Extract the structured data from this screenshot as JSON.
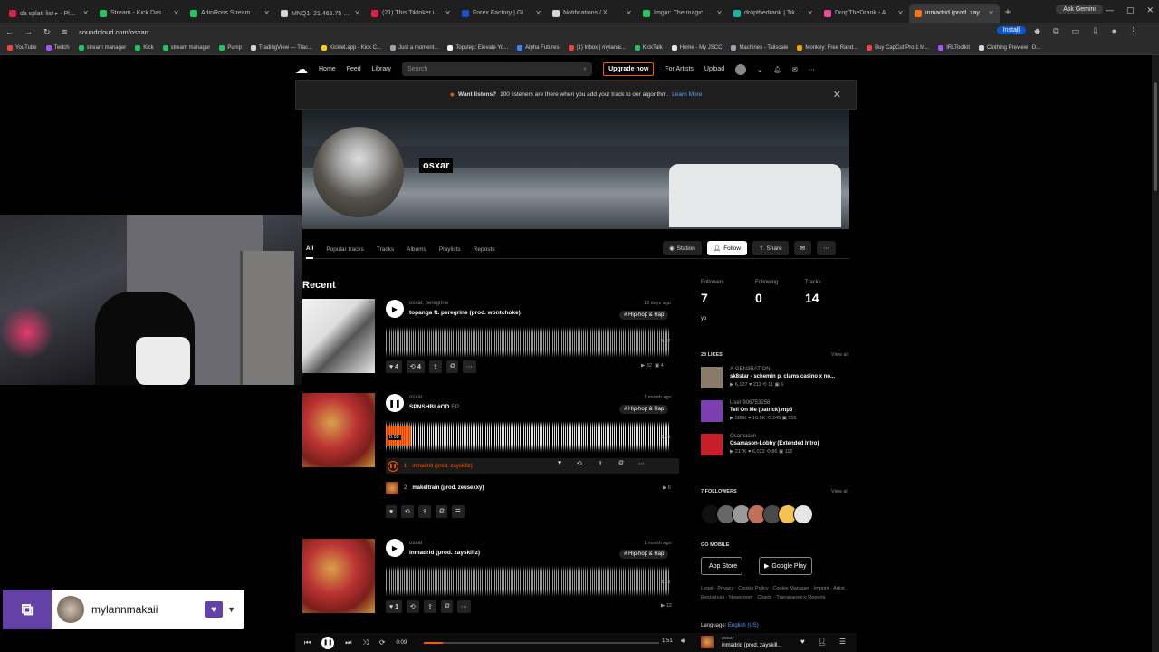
{
  "browser": {
    "tabs": [
      {
        "title": "da splatt list ▸ - Playlis",
        "color": "#e11d48"
      },
      {
        "title": "Stream - Kick Dashboard",
        "color": "#22c55e"
      },
      {
        "title": "AdinRoss Stream - Watc",
        "color": "#22c55e"
      },
      {
        "title": "MNQ1! 21,465.75 ▾ -0.",
        "color": "#d1d5db"
      },
      {
        "title": "(21) This Tiktoker is DM",
        "color": "#e11d48"
      },
      {
        "title": "Forex Factory | Global m",
        "color": "#1d4ed8"
      },
      {
        "title": "Notifications / X",
        "color": "#d1d5db"
      },
      {
        "title": "Imgur: The magic of the",
        "color": "#22c55e"
      },
      {
        "title": "dropthedrank | TikTok,",
        "color": "#14b8a6"
      },
      {
        "title": "DropTheDrank - Apple I",
        "color": "#ec4899"
      },
      {
        "title": "inmadrid (prod. zay",
        "color": "#f97316"
      }
    ],
    "new_tab": "+",
    "ask_gemini": "Ask Gemini",
    "url": "soundcloud.com/osxarr",
    "install": "Install",
    "bookmarks": [
      {
        "label": "YouTube",
        "color": "#ef4444"
      },
      {
        "label": "Twitch",
        "color": "#a855f7"
      },
      {
        "label": "stream manager",
        "color": "#22c55e"
      },
      {
        "label": "Kick",
        "color": "#22c55e"
      },
      {
        "label": "stream manager",
        "color": "#22c55e"
      },
      {
        "label": "Pump",
        "color": "#22c55e"
      },
      {
        "label": "TradingView — Trac...",
        "color": "#d1d5db"
      },
      {
        "label": "Kicklet.app - Kick C...",
        "color": "#facc15"
      },
      {
        "label": "Just a moment...",
        "color": "#9ca3af"
      },
      {
        "label": "Topstep: Elevate Yo...",
        "color": "#f3f4f6"
      },
      {
        "label": "Alpha Futures",
        "color": "#3b82f6"
      },
      {
        "label": "(1) Inbox | mylanai...",
        "color": "#ef4444"
      },
      {
        "label": "KickTalk",
        "color": "#22c55e"
      },
      {
        "label": "Home - My JSCC",
        "color": "#e5e7eb"
      },
      {
        "label": "Machines - Tailscale",
        "color": "#9ca3af"
      },
      {
        "label": "Monkey: Free Rand...",
        "color": "#f59e0b"
      },
      {
        "label": "Buy CapCut Pro 1 M...",
        "color": "#ef4444"
      },
      {
        "label": "IRLToolkit",
        "color": "#a855f7"
      },
      {
        "label": "Clothing Preview | D...",
        "color": "#d1d5db"
      }
    ]
  },
  "nav": {
    "home": "Home",
    "feed": "Feed",
    "library": "Library",
    "search_placeholder": "Search",
    "upgrade": "Upgrade now",
    "for_artists": "For Artists",
    "upload": "Upload"
  },
  "notice": {
    "strong": "Want listens?",
    "text": "100 listeners are there when you add your track to our algorithm.",
    "link": "Learn More"
  },
  "profile": {
    "name": "osxar",
    "tabs": [
      "All",
      "Popular tracks",
      "Tracks",
      "Albums",
      "Playlists",
      "Reposts"
    ],
    "station": "Station",
    "follow": "Follow",
    "share": "Share"
  },
  "recent_heading": "Recent",
  "tracks": [
    {
      "artist": "osxar, peregrine",
      "title": "topanga ft. peregrine (prod. wontchoke)",
      "age": "18 days ago",
      "genre": "# Hip-hop & Rap",
      "duration": "2:37",
      "likes": "4",
      "reposts": "4",
      "plays": "32",
      "comments": "4"
    },
    {
      "artist": "osxar",
      "title": "SPNSHBL#OD",
      "type": "EP",
      "age": "1 month ago",
      "genre": "# Hip-hop & Rap",
      "elapsed": "0:09",
      "duration": "1:51",
      "sub": [
        {
          "num": "1",
          "title": "inmadrid (prod. zayskillz)"
        },
        {
          "num": "2",
          "title": "makeitrain (prod. zeusexxy)",
          "plays": "6"
        }
      ]
    },
    {
      "artist": "osxar",
      "title": "inmadrid (prod. zayskillz)",
      "age": "1 month ago",
      "genre": "# Hip-hop & Rap",
      "duration": "1:51",
      "likes": "1",
      "plays": "12"
    }
  ],
  "sidebar": {
    "followers_label": "Followers",
    "followers": "7",
    "following_label": "Following",
    "following": "0",
    "tracks_label": "Tracks",
    "tracks": "14",
    "bio": "yo",
    "likes_heading": "28 LIKES",
    "view_all": "View all",
    "likes": [
      {
        "artist": "X-GEN3RATION.",
        "title": "sk8star - schemin p. clams casino x no...",
        "stats": "▶ 6,127  ♥ 211  ⟲ 11  ▣ 6",
        "color": "#8a7a6a"
      },
      {
        "artist": "User 906753258",
        "title": "Tell On Me (patrick).mp3",
        "stats": "▶ 586K  ♥ 16.5K  ⟲ 245  ▣ 555",
        "color": "#7a3fb0"
      },
      {
        "artist": "Osamason",
        "title": "Osamason-Lobby (Extended Intro)",
        "stats": "▶ 217K  ♥ 6,022  ⟲ 86  ▣ 112",
        "color": "#c81e2a"
      }
    ],
    "followers_heading": "7 FOLLOWERS",
    "follower_colors": [
      "#111111",
      "#666666",
      "#999999",
      "#c0705a",
      "#4a4a4a",
      "#f2c14e",
      "#e6e6e6"
    ],
    "go_mobile": "GO MOBILE",
    "app_store": "App Store",
    "google_play": "Google Play",
    "legal": "Legal · Privacy · Cookie Policy · Cookie Manager · Imprint · Artist Resources · Newsroom · Charts · Transparency Reports",
    "language_label": "Language:",
    "language": "English (US)"
  },
  "player": {
    "elapsed": "0:09",
    "duration": "1:51",
    "progress": 0.081,
    "now_artist": "osxar",
    "now_title": "inmadrid (prod. zayskill..."
  },
  "twitch": {
    "username": "mylannmakaii"
  }
}
